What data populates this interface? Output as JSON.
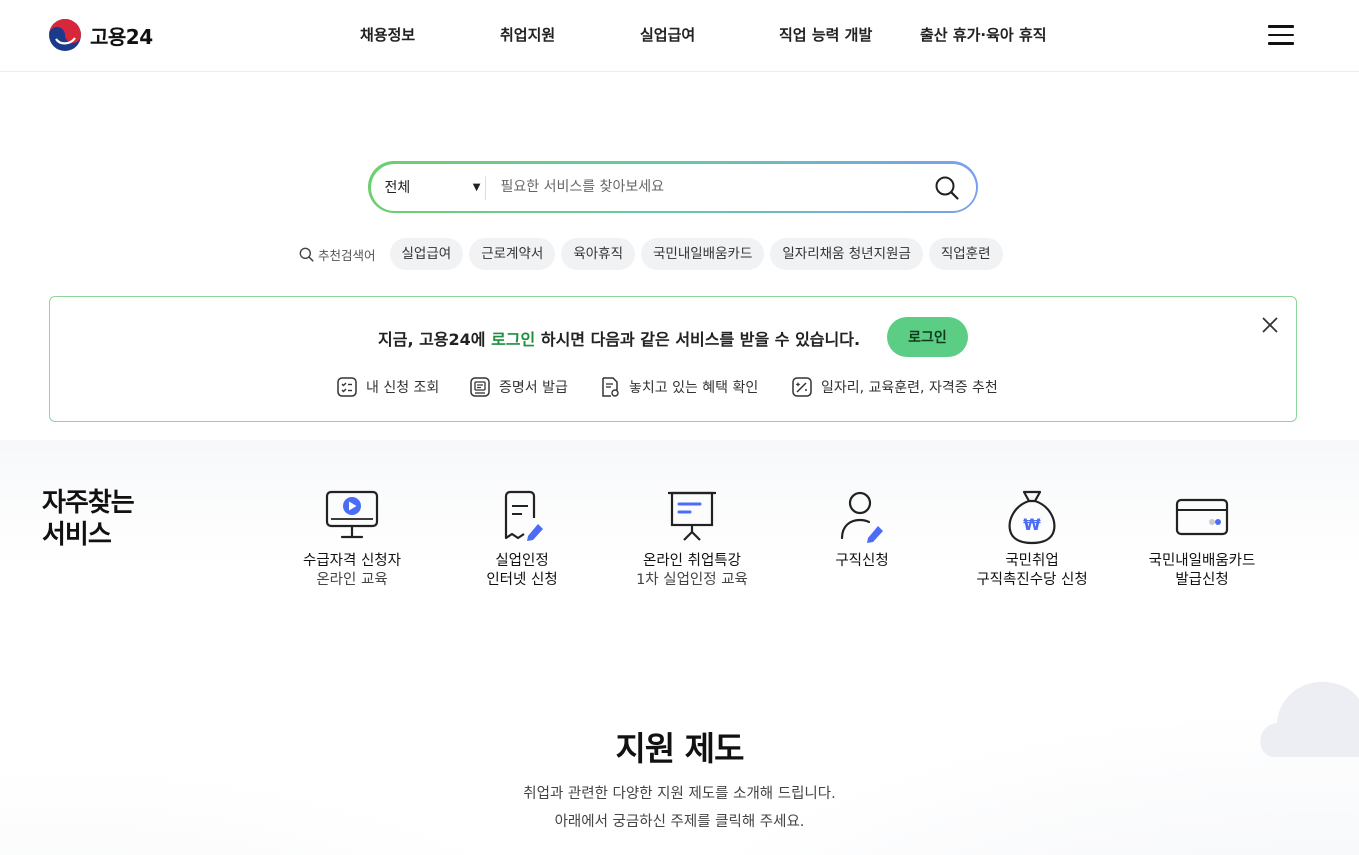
{
  "header": {
    "logo_text": "고용24",
    "nav": [
      "채용정보",
      "취업지원",
      "실업급여",
      "직업 능력 개발",
      "출산 휴가·육아 휴직"
    ]
  },
  "search": {
    "category": "전체",
    "placeholder": "필요한 서비스를 찾아보세요",
    "value": ""
  },
  "recommended": {
    "label": "추천검색어",
    "keywords": [
      "실업급여",
      "근로계약서",
      "육아휴직",
      "국민내일배움카드",
      "일자리채움 청년지원금",
      "직업훈련"
    ]
  },
  "login_banner": {
    "msg_prefix": "지금, 고용24에",
    "msg_highlight": "로그인",
    "msg_suffix": "하시면 다음과 같은 서비스를 받을 수 있습니다.",
    "button": "로그인",
    "services": [
      "내 신청 조회",
      "증명서 발급",
      "놓치고 있는 혜택 확인",
      "일자리, 교육훈련, 자격증 추천"
    ]
  },
  "frequent": {
    "title_line1": "자주찾는",
    "title_line2": "서비스",
    "items": [
      {
        "line1": "수급자격 신청자",
        "line2": "온라인 교육",
        "icon": "monitor-play-icon"
      },
      {
        "line1": "실업인정",
        "line2": "인터넷 신청",
        "icon": "document-pen-icon"
      },
      {
        "line1": "온라인 취업특강",
        "line2": "1차 실업인정 교육",
        "icon": "presentation-board-icon"
      },
      {
        "line1": "구직신청",
        "line2": "",
        "icon": "person-pen-icon"
      },
      {
        "line1": "국민취업",
        "line2": "구직촉진수당 신청",
        "icon": "money-bag-won-icon"
      },
      {
        "line1": "국민내일배움카드",
        "line2": "발급신청",
        "icon": "card-icon"
      }
    ]
  },
  "support": {
    "title": "지원 제도",
    "desc1": "취업과 관련한 다양한 지원 제도를 소개해 드립니다.",
    "desc2": "아래에서 궁금하신 주제를 클릭해 주세요."
  },
  "colors": {
    "accent_green": "#5ccd85",
    "highlight_green": "#1d8f3f",
    "icon_blue": "#4a6cf7"
  }
}
